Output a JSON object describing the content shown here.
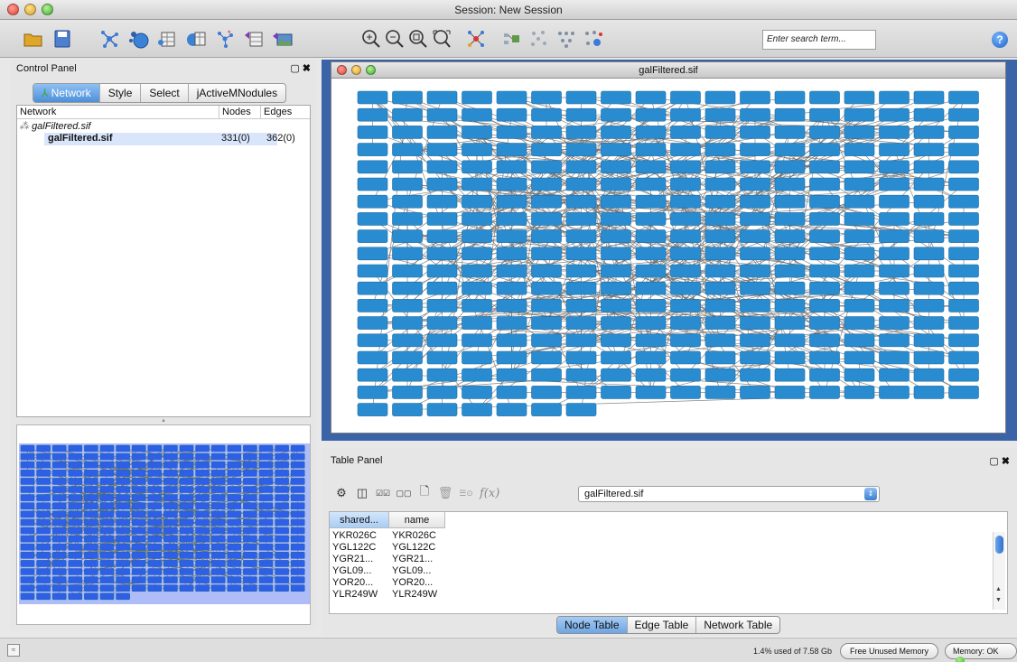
{
  "window": {
    "title": "Session: New Session"
  },
  "toolbar": {
    "buttons": [
      "open-session-icon",
      "save-session-icon",
      "import-network-file-icon",
      "import-network-web-icon",
      "import-table-file-icon",
      "import-table-web-icon",
      "new-network-icon",
      "export-table-icon",
      "export-image-icon",
      "zoom-in-icon",
      "zoom-out-icon",
      "zoom-selected-icon",
      "zoom-fit-icon",
      "apply-layout-icon",
      "first-neighbors-icon",
      "hide-selected-icon",
      "show-all-icon",
      "new-network-from-selection-icon"
    ],
    "search_placeholder": "Enter search term...",
    "help_label": "?"
  },
  "control_panel": {
    "title": "Control Panel",
    "tabs": [
      "Network",
      "Style",
      "Select",
      "jActiveMNodules"
    ],
    "active_tab": "Network",
    "columns": [
      "Network",
      "Nodes",
      "Edges"
    ],
    "collection": "galFiltered.sif",
    "network": {
      "name": "galFiltered.sif",
      "nodes": "331(0)",
      "edges": "362(0)"
    }
  },
  "network_view": {
    "title": "galFiltered.sif",
    "node_color": "#2a8cd0",
    "edge_color": "#6a6a6a"
  },
  "table_panel": {
    "title": "Table Panel",
    "network_selector": "galFiltered.sif",
    "fx_label": "f(x)",
    "columns": [
      "shared...",
      "name"
    ],
    "rows": [
      [
        "YKR026C",
        "YKR026C"
      ],
      [
        "YGL122C",
        "YGL122C"
      ],
      [
        "YGR21...",
        "YGR21..."
      ],
      [
        "YGL09...",
        "YGL09..."
      ],
      [
        "YOR20...",
        "YOR20..."
      ],
      [
        "YLR249W",
        "YLR249W"
      ]
    ],
    "bottom_tabs": [
      "Node Table",
      "Edge Table",
      "Network Table"
    ],
    "active_bottom_tab": "Node Table"
  },
  "status_bar": {
    "memory_text": "1.4% used of 7.58 Gb",
    "free_memory_label": "Free Unused Memory",
    "memory_status_label": "Memory: OK"
  }
}
